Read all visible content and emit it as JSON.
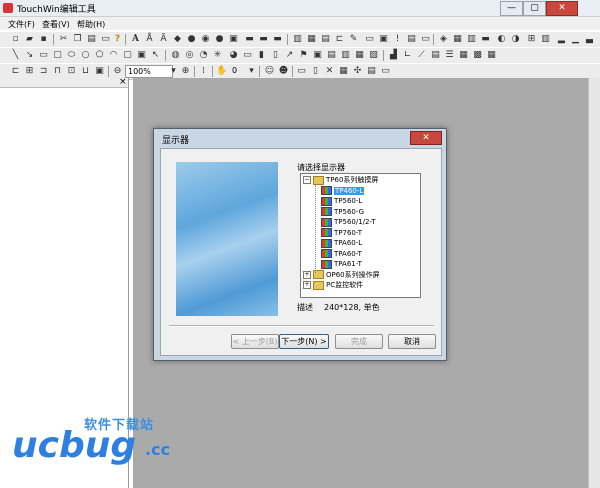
{
  "window": {
    "title": "TouchWin编辑工具",
    "min": "—",
    "max": "▢",
    "close": "✕"
  },
  "menu": [
    {
      "label": "文件(F)"
    },
    {
      "label": "查看(V)"
    },
    {
      "label": "帮助(H)"
    }
  ],
  "toolbar3": {
    "zoom": "100%",
    "layer": "0"
  },
  "dialog": {
    "title": "显示器",
    "close": "✕",
    "prompt": "请选择显示器",
    "tree": [
      {
        "label": "TP60系列触摸屏",
        "level": 0,
        "expander": "−",
        "type": "folder"
      },
      {
        "label": "TP460-L",
        "level": 1,
        "type": "device",
        "selected": true
      },
      {
        "label": "TP560-L",
        "level": 1,
        "type": "device"
      },
      {
        "label": "TP560-G",
        "level": 1,
        "type": "device"
      },
      {
        "label": "TP560/1/2-T",
        "level": 1,
        "type": "device"
      },
      {
        "label": "TP760-T",
        "level": 1,
        "type": "device"
      },
      {
        "label": "TPA60-L",
        "level": 1,
        "type": "device"
      },
      {
        "label": "TPA60-T",
        "level": 1,
        "type": "device"
      },
      {
        "label": "TPA61-T",
        "level": 1,
        "type": "device"
      },
      {
        "label": "OP60系列操作屏",
        "level": 0,
        "expander": "+",
        "type": "folder"
      },
      {
        "label": "PC监控软件",
        "level": 0,
        "expander": "+",
        "type": "folder"
      }
    ],
    "desc_label": "描述",
    "desc_value": "240*128, 单色",
    "buttons": {
      "back": "< 上一步(B)",
      "next": "下一步(N) >",
      "finish": "完成",
      "cancel": "取消"
    }
  },
  "watermark": {
    "cn": "软件下载站",
    "en": "ucbug",
    "cc": ".cc"
  },
  "colors": {
    "workspace": "#aaaaaa",
    "selection": "#3399ff",
    "dialog_frame": "#c9d6e4"
  }
}
